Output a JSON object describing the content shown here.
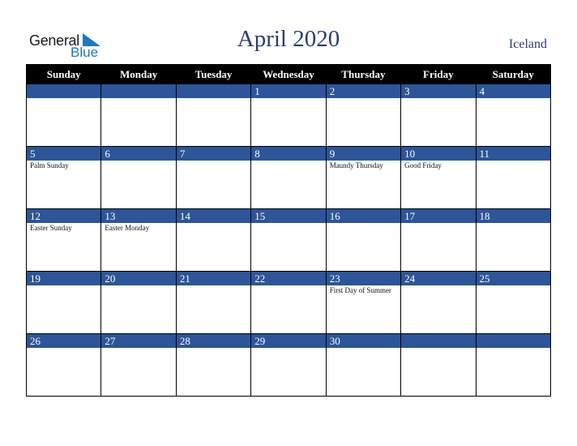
{
  "logo": {
    "word1": "General",
    "word2": "Blue"
  },
  "header": {
    "title": "April 2020",
    "country": "Iceland"
  },
  "calendar": {
    "weekdays": [
      "Sunday",
      "Monday",
      "Tuesday",
      "Wednesday",
      "Thursday",
      "Friday",
      "Saturday"
    ],
    "weeks": [
      {
        "days": [
          "",
          "",
          "",
          "1",
          "2",
          "3",
          "4"
        ],
        "events": [
          "",
          "",
          "",
          "",
          "",
          "",
          ""
        ]
      },
      {
        "days": [
          "5",
          "6",
          "7",
          "8",
          "9",
          "10",
          "11"
        ],
        "events": [
          "Palm Sunday",
          "",
          "",
          "",
          "Maundy Thursday",
          "Good Friday",
          ""
        ]
      },
      {
        "days": [
          "12",
          "13",
          "14",
          "15",
          "16",
          "17",
          "18"
        ],
        "events": [
          "Easter Sunday",
          "Easter Monday",
          "",
          "",
          "",
          "",
          ""
        ]
      },
      {
        "days": [
          "19",
          "20",
          "21",
          "22",
          "23",
          "24",
          "25"
        ],
        "events": [
          "",
          "",
          "",
          "",
          "First Day of Summer",
          "",
          ""
        ]
      },
      {
        "days": [
          "26",
          "27",
          "28",
          "29",
          "30",
          "",
          ""
        ],
        "events": [
          "",
          "",
          "",
          "",
          "",
          "",
          ""
        ]
      }
    ]
  }
}
